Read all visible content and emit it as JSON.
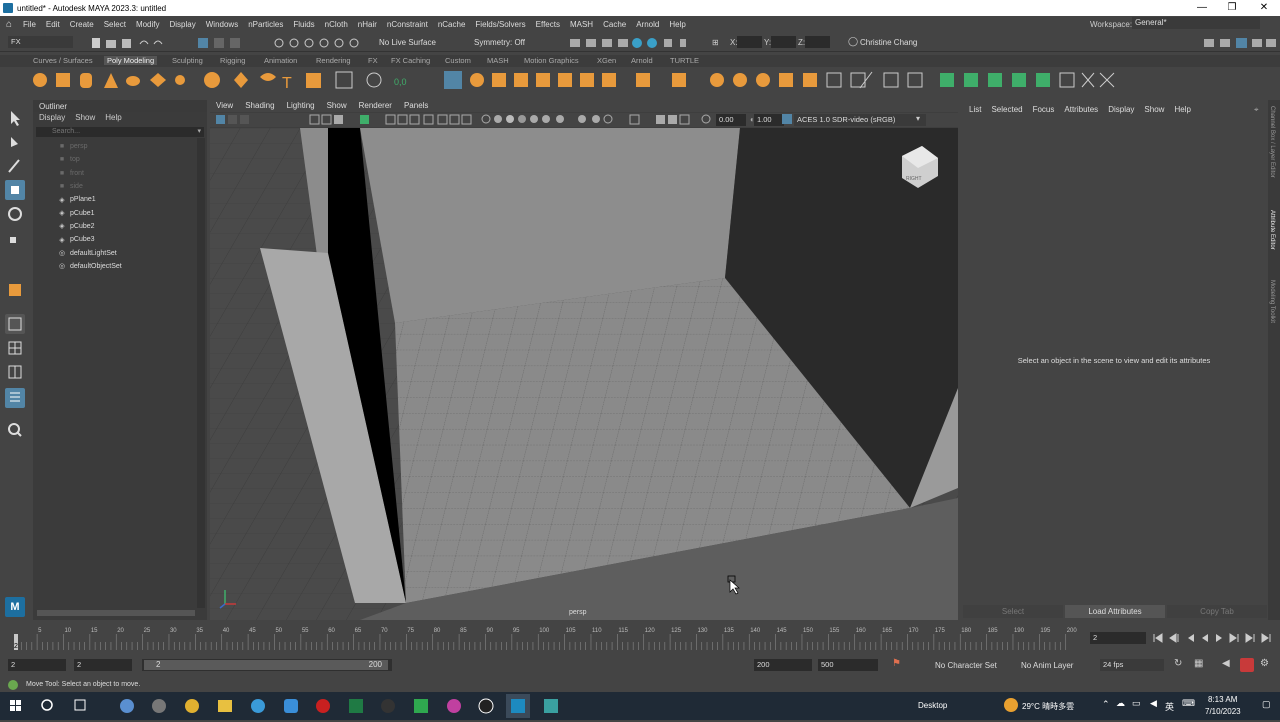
{
  "window": {
    "title": "untitled* - Autodesk MAYA 2023.3: untitled",
    "min": "—",
    "max": "❐",
    "close": "✕"
  },
  "menu": [
    "File",
    "Edit",
    "Create",
    "Select",
    "Modify",
    "Display",
    "Windows",
    "nParticles",
    "Fluids",
    "nCloth",
    "nHair",
    "nConstraint",
    "nCache",
    "Fields/Solvers",
    "Effects",
    "MASH",
    "Cache",
    "Arnold",
    "Help"
  ],
  "workspace": {
    "label": "Workspace:",
    "value": "General*"
  },
  "statusline": {
    "mode": "FX",
    "live_surface": "No Live Surface",
    "symmetry": "Symmetry: Off",
    "x": "X:",
    "y": "Y:",
    "z": "Z:",
    "user": "Christine Chang"
  },
  "shelf_tabs": [
    "Curves / Surfaces",
    "Poly Modeling",
    "Sculpting",
    "Rigging",
    "Animation",
    "Rendering",
    "FX",
    "FX Caching",
    "Custom",
    "MASH",
    "Motion Graphics",
    "XGen",
    "Arnold",
    "TURTLE"
  ],
  "shelf_active": "Poly Modeling",
  "outliner": {
    "title": "Outliner",
    "menu": [
      "Display",
      "Show",
      "Help"
    ],
    "search_placeholder": "Search...",
    "items": [
      {
        "label": "persp",
        "kind": "camera"
      },
      {
        "label": "top",
        "kind": "camera"
      },
      {
        "label": "front",
        "kind": "camera"
      },
      {
        "label": "side",
        "kind": "camera"
      },
      {
        "label": "pPlane1",
        "kind": "mesh"
      },
      {
        "label": "pCube1",
        "kind": "mesh"
      },
      {
        "label": "pCube2",
        "kind": "mesh"
      },
      {
        "label": "pCube3",
        "kind": "mesh"
      },
      {
        "label": "defaultLightSet",
        "kind": "set"
      },
      {
        "label": "defaultObjectSet",
        "kind": "set"
      }
    ]
  },
  "viewport": {
    "menu": [
      "View",
      "Shading",
      "Lighting",
      "Show",
      "Renderer",
      "Panels"
    ],
    "exposure": "0.00",
    "gamma": "1.00",
    "color_space": "ACES 1.0 SDR-video (sRGB)",
    "camera_label": "persp",
    "viewcube_label": "RIGHT"
  },
  "attribute_editor": {
    "menu": [
      "List",
      "Selected",
      "Focus",
      "Attributes",
      "Display",
      "Show",
      "Help"
    ],
    "message": "Select an object in the scene to view and edit its attributes",
    "buttons": [
      "Select",
      "Load Attributes",
      "Copy Tab"
    ]
  },
  "side_tabs": [
    "Channel Box / Layer Editor",
    "Attribute Editor",
    "Modeling Toolkit"
  ],
  "timeslider": {
    "ticks": [
      "5",
      "10",
      "15",
      "20",
      "25",
      "30",
      "35",
      "40",
      "45",
      "50",
      "55",
      "60",
      "65",
      "70",
      "75",
      "80",
      "85",
      "90",
      "95",
      "100",
      "105",
      "110",
      "115",
      "120",
      "125",
      "130",
      "135",
      "140",
      "145",
      "150",
      "155",
      "160",
      "165",
      "170",
      "175",
      "180",
      "185",
      "190",
      "195",
      "200"
    ],
    "current": "2",
    "current_frame_field": "2"
  },
  "range": {
    "start": "2",
    "playback_start": "2",
    "slider_start": "2",
    "slider_end": "200",
    "playback_end": "200",
    "end": "500",
    "character_set": "No Character Set",
    "anim_layer": "No Anim Layer",
    "fps": "24 fps"
  },
  "helpline": "Move Tool: Select an object to move.",
  "taskbar": {
    "desktop": "Desktop",
    "weather": "29°C  晴時多雲",
    "lang": "英",
    "time": "8:13 AM",
    "date": "7/10/2023"
  },
  "colors": {
    "accent": "#5b8fc0",
    "shelf_orange": "#e89a3c",
    "shelf_green": "#3fae6a",
    "active_tool": "#5285a6",
    "record_red": "#c83a3a"
  }
}
